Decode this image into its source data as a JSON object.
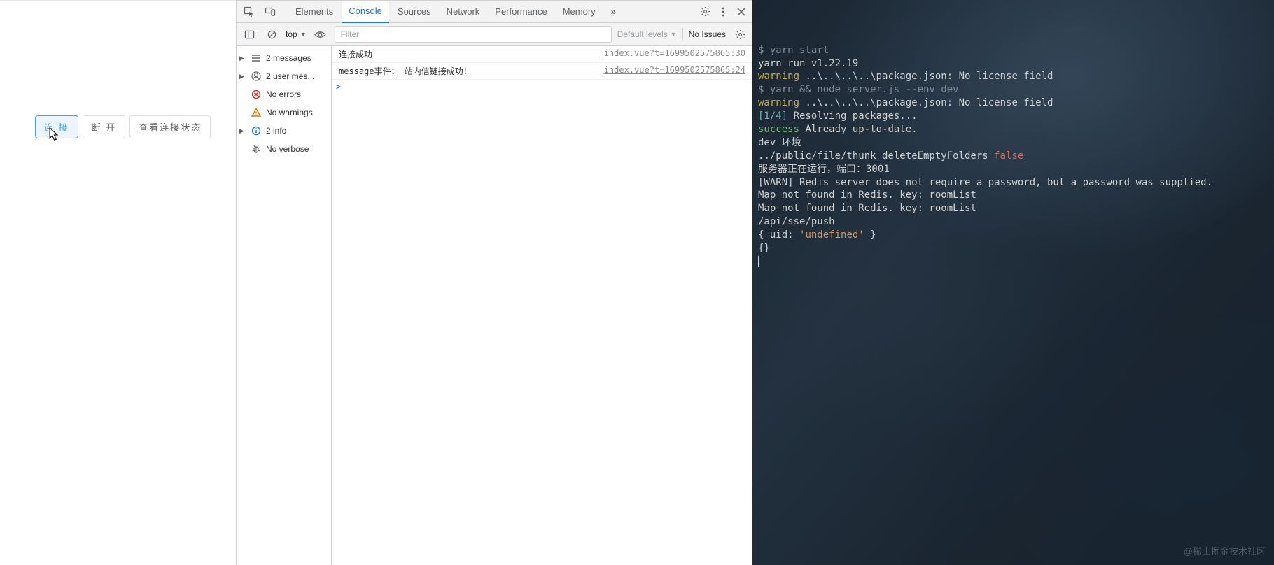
{
  "app": {
    "buttons": {
      "connect": "连 接",
      "disconnect": "断 开",
      "status": "查看连接状态"
    }
  },
  "devtools": {
    "tabs": {
      "elements": "Elements",
      "console": "Console",
      "sources": "Sources",
      "network": "Network",
      "performance": "Performance",
      "memory": "Memory",
      "more": "»"
    },
    "toolbar": {
      "context": "top",
      "filter_placeholder": "Filter",
      "levels": "Default levels",
      "issues": "No Issues"
    },
    "sidebar": {
      "messages": "2 messages",
      "user": "2 user mes...",
      "errors": "No errors",
      "warnings": "No warnings",
      "info": "2 info",
      "verbose": "No verbose"
    },
    "log": {
      "line1_msg": "连接成功",
      "line1_src": "index.vue?t=1699502575865:30",
      "line2_msg": "message事件：  站内信链接成功！",
      "line2_src": "index.vue?t=1699502575865:24",
      "prompt": ">"
    }
  },
  "terminal": {
    "l1_prompt": "$ ",
    "l1_cmd": "yarn start",
    "l2": "yarn run v1.22.19",
    "l3_warn": "warning ",
    "l3_rest": "..\\..\\..\\..\\package.json: No license field",
    "l4_prompt": "$ ",
    "l4_cmd": "yarn && node server.js --env dev",
    "l5_warn": "warning ",
    "l5_rest": "..\\..\\..\\..\\package.json: No license field",
    "l6_step": "[1/4] ",
    "l6_rest": "Resolving packages...",
    "l7_succ": "success ",
    "l7_rest": "Already up-to-date.",
    "l8": "dev 环境",
    "l9a": "../public/file/thunk deleteEmptyFolders ",
    "l9b": "false",
    "l10": "服务器正在运行，端口：3001",
    "l11": "[WARN] Redis server does not require a password, but a password was supplied.",
    "l12": "Map not found in Redis. key: roomList",
    "l13": "Map not found in Redis. key: roomList",
    "l14": "/api/sse/push",
    "l15a": "{ uid: ",
    "l15b": "'undefined'",
    "l15c": " }",
    "l16": "{}"
  },
  "watermark": "@稀土掘金技术社区"
}
